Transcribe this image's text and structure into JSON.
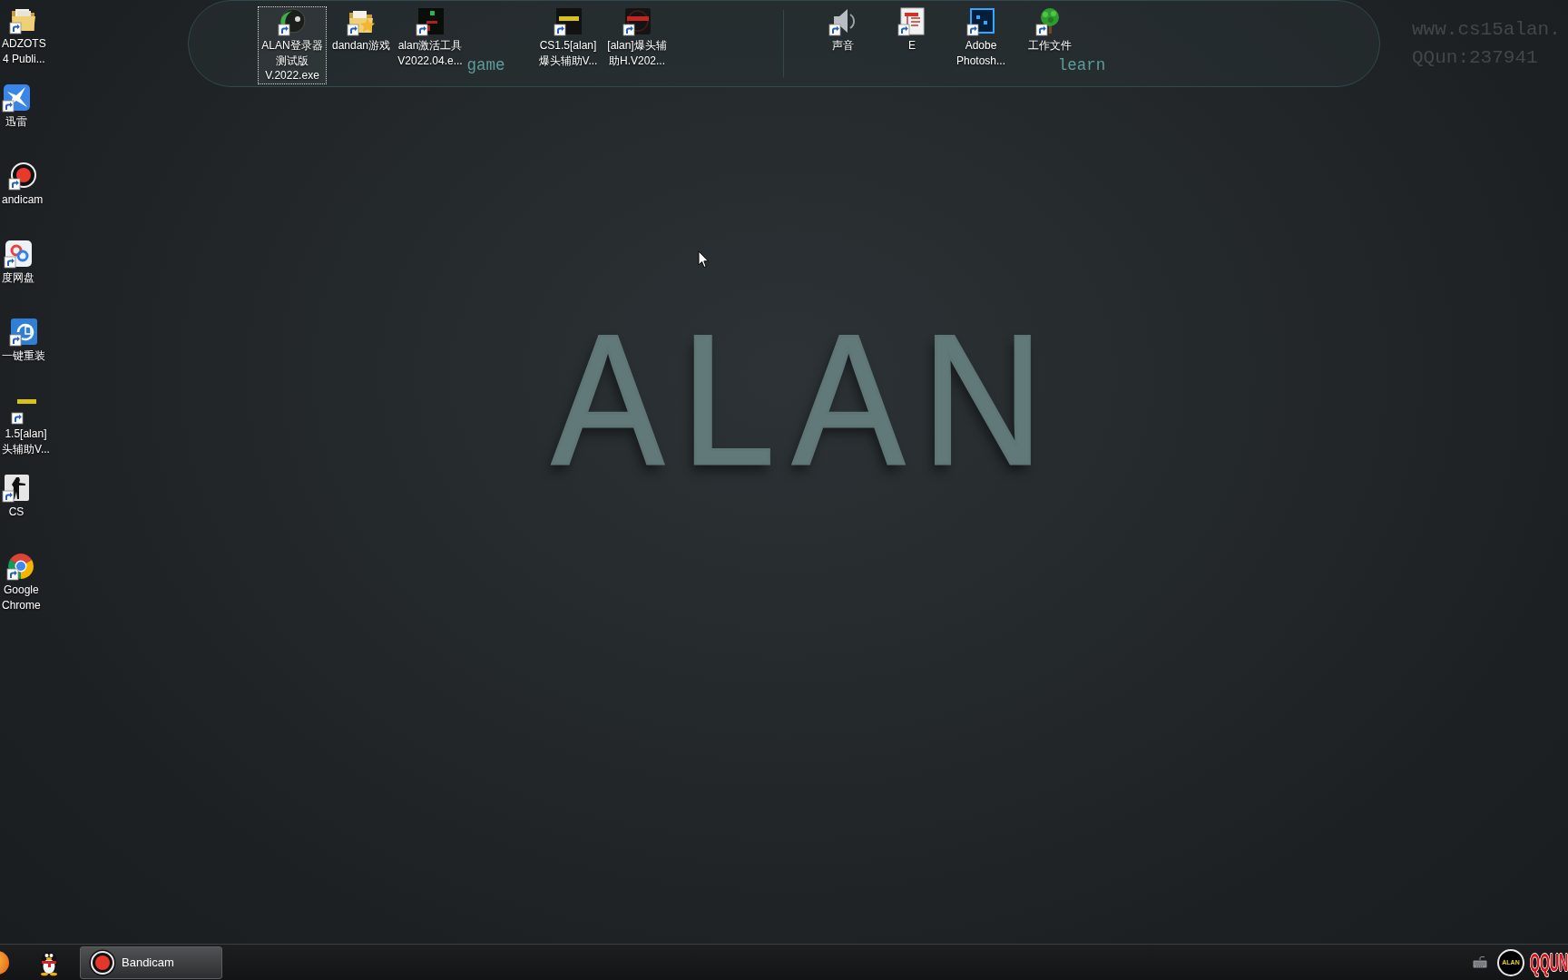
{
  "desktop": {
    "wallpaper_text": "ALAN",
    "overlay_lines": [
      "www.cs15alan.",
      "QQun:237941"
    ]
  },
  "left_icons": [
    {
      "label": "ADZOTS\n4 Publi...",
      "selected": false
    },
    {
      "label": "迅雷",
      "selected": false
    },
    {
      "label": "andicam",
      "selected": false
    },
    {
      "label": "度网盘",
      "selected": false
    },
    {
      "label": "一键重装",
      "selected": false
    },
    {
      "label": "1.5[alan]\n头辅助V...",
      "selected": false
    },
    {
      "label": "CS",
      "selected": false
    },
    {
      "label": "Google\nChrome",
      "selected": false
    }
  ],
  "fences": [
    {
      "title": "game",
      "items": [
        {
          "label": "ALAN登录器测试版\nV.2022.exe",
          "selected": true
        },
        {
          "label": "dandan游戏",
          "selected": false
        },
        {
          "label": "alan激活工具\nV2022.04.e...",
          "selected": false
        },
        {
          "label": "CS1.5[alan]\n爆头辅助V...",
          "selected": false
        },
        {
          "label": "[alan]爆头辅助H.V202...",
          "selected": false
        }
      ]
    },
    {
      "title": "learn",
      "items": [
        {
          "label": "声音",
          "selected": false
        },
        {
          "label": "E",
          "selected": false
        },
        {
          "label": "Adobe\nPhotosh...",
          "selected": false
        },
        {
          "label": "工作文件",
          "selected": false
        }
      ]
    }
  ],
  "taskbar": {
    "buttons": [
      {
        "label": "Bandicam"
      }
    ],
    "tray_logo": "ALAN",
    "tray_text": "QQUN"
  }
}
